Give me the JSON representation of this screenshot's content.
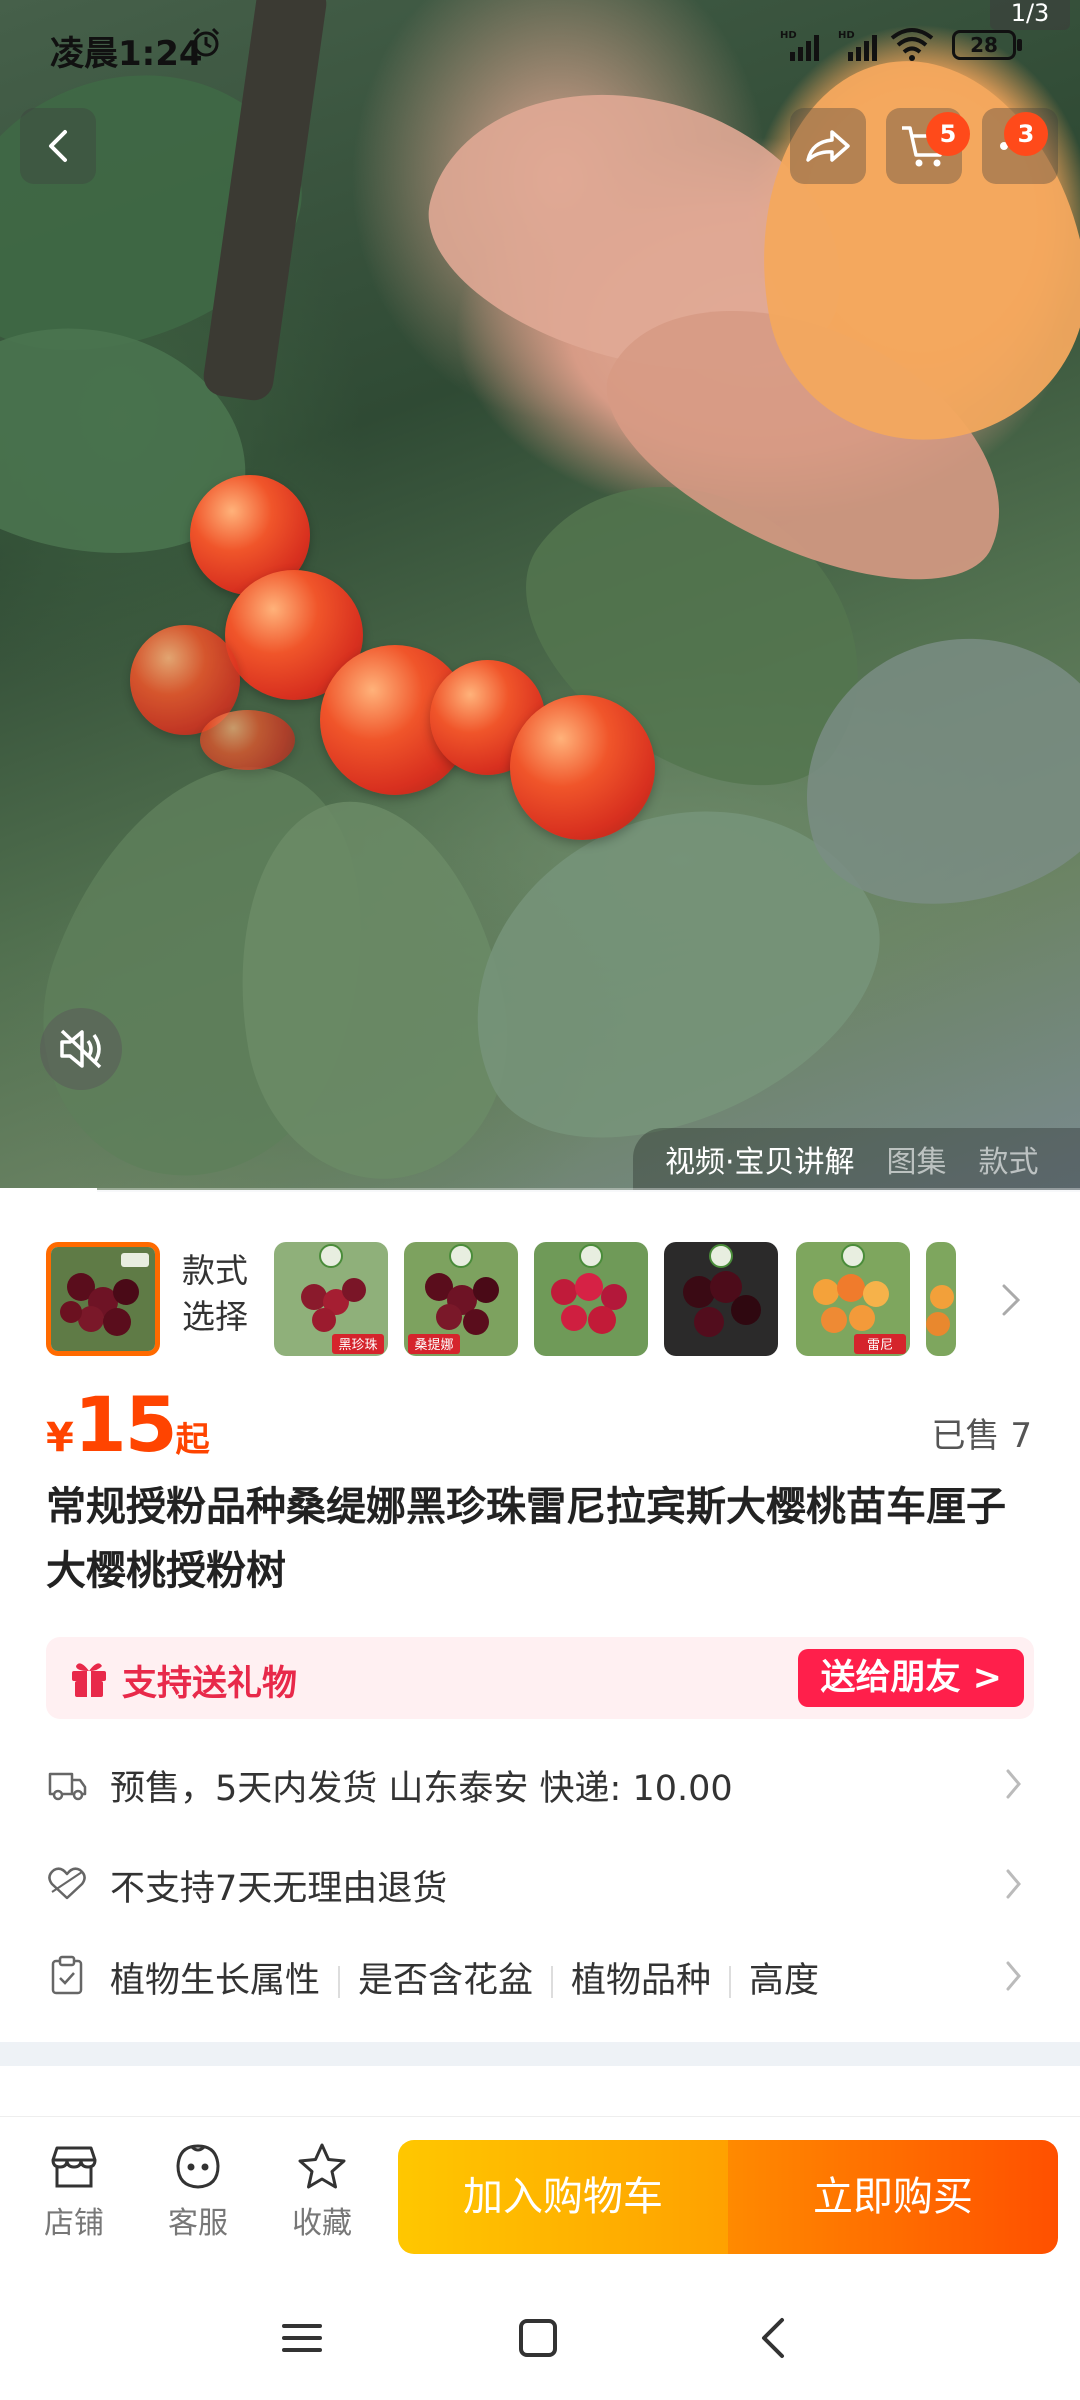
{
  "status_bar": {
    "time": "凌晨1:24",
    "battery": "28",
    "page_indicator": "1/3"
  },
  "top_nav": {
    "cart_badge": "5",
    "more_badge": "3"
  },
  "media": {
    "tabs": [
      "视频·宝贝讲解",
      "图集",
      "款式"
    ],
    "video_progress": 0.09
  },
  "product": {
    "style_label": "款式选择",
    "thumb_captions": [
      "",
      "黑珍珠",
      "桑提娜",
      "",
      "",
      "雷尼",
      ""
    ],
    "price_symbol": "¥",
    "price": "15",
    "price_suffix": "起",
    "sold": "已售 7",
    "title": "常规授粉品种桑缇娜黑珍珠雷尼拉宾斯大樱桃苗车厘子大樱桃授粉树"
  },
  "gift": {
    "text": "支持送礼物",
    "button": "送给朋友 >"
  },
  "info": {
    "shipping": "预售，5天内发货  山东泰安  快递: 10.00",
    "returns": "不支持7天无理由退货",
    "attributes": [
      "植物生长属性",
      "是否含花盆",
      "植物品种",
      "高度"
    ]
  },
  "action_bar": {
    "shop": "店铺",
    "service": "客服",
    "favorite": "收藏",
    "add_to_cart": "加入购物车",
    "buy_now": "立即购买"
  },
  "colors": {
    "accent": "#ff4400",
    "gift_red": "#ff1f4b",
    "cart_yellow": "#ffb000",
    "buy_orange": "#ff5a00"
  }
}
